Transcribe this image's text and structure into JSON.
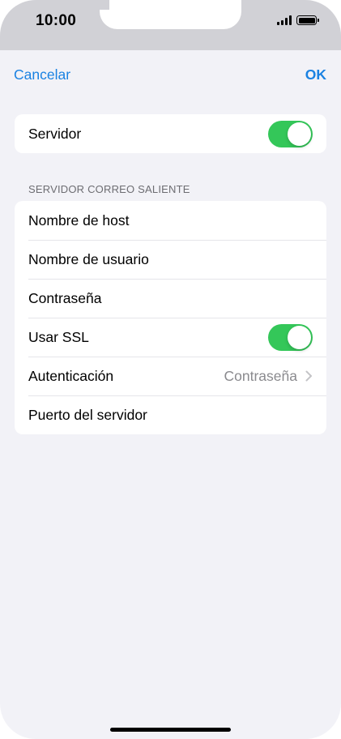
{
  "status_bar": {
    "time": "10:00",
    "icons": [
      "signal-icon",
      "battery-icon"
    ]
  },
  "nav": {
    "cancel_label": "Cancelar",
    "ok_label": "OK",
    "accent_color": "#1a82e2"
  },
  "server_group": {
    "label": "Servidor",
    "toggle_on": true
  },
  "outgoing_section": {
    "header": "SERVIDOR CORREO SALIENTE",
    "rows": {
      "host": {
        "label": "Nombre de host"
      },
      "username": {
        "label": "Nombre de usuario"
      },
      "password": {
        "label": "Contraseña"
      },
      "ssl": {
        "label": "Usar SSL",
        "toggle_on": true
      },
      "auth": {
        "label": "Autenticación",
        "value": "Contraseña"
      },
      "port": {
        "label": "Puerto del servidor"
      }
    }
  },
  "colors": {
    "toggle_on": "#34c759",
    "background": "#f2f2f7",
    "secondary_text": "#8a8a8e"
  }
}
